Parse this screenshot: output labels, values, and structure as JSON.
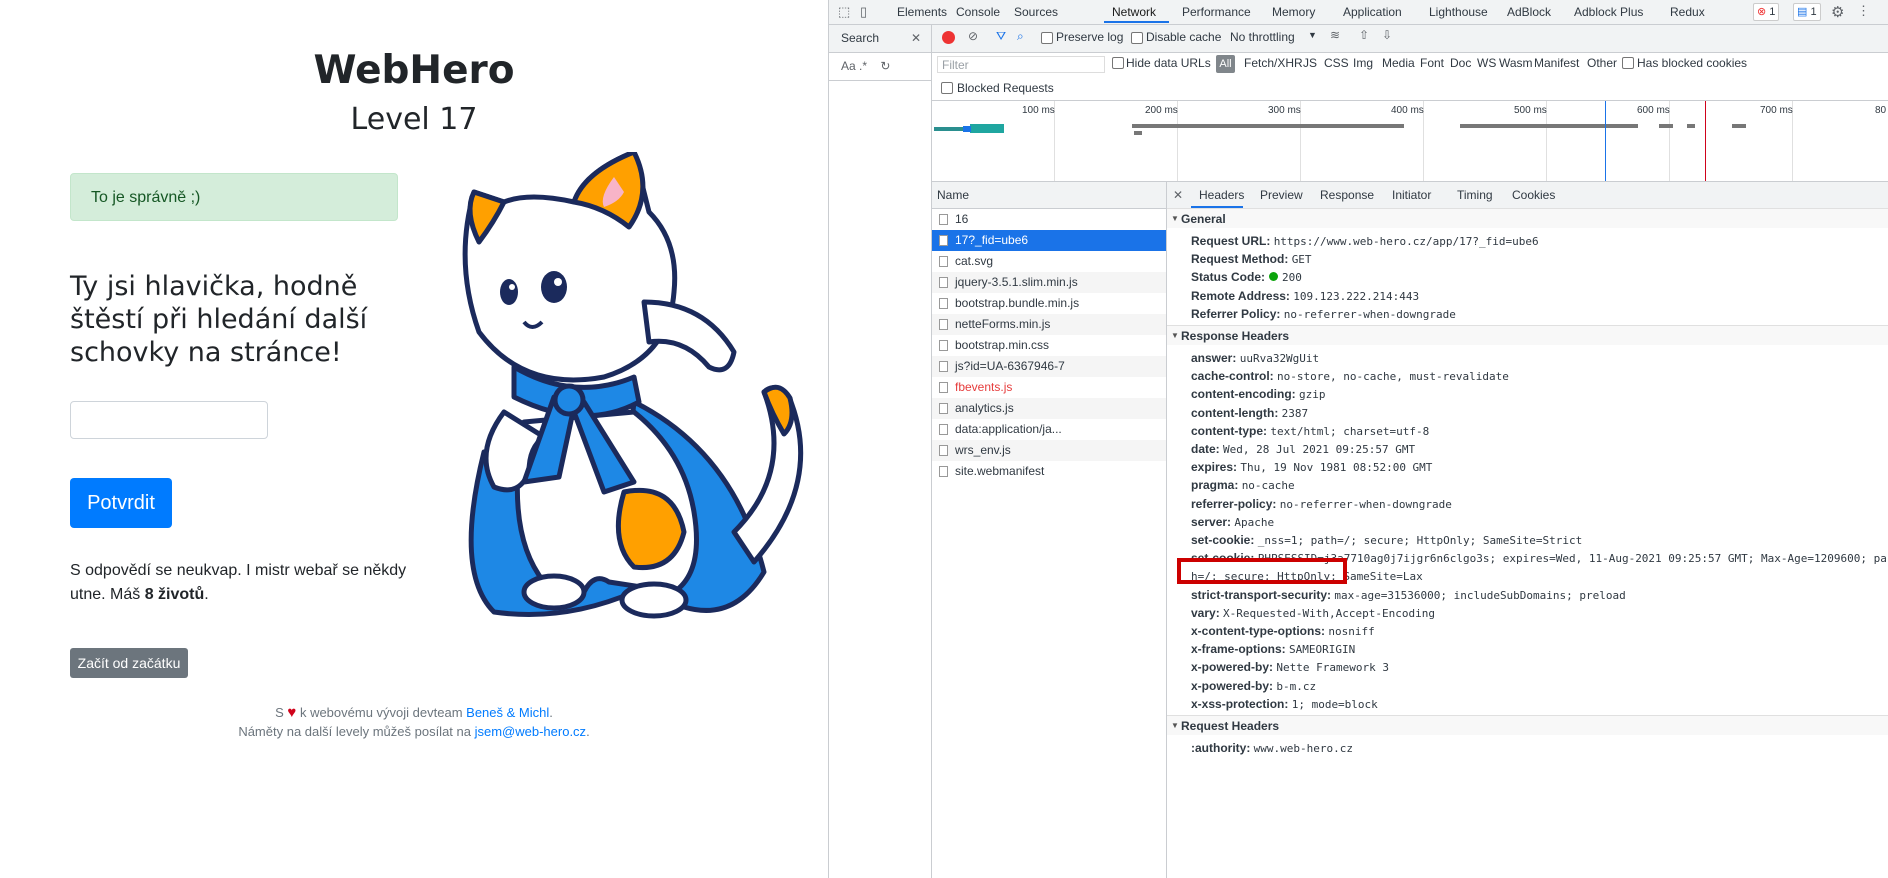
{
  "webpage": {
    "title": "WebHero",
    "level": "Level 17",
    "alert": "To je správně ;)",
    "hint": "Ty jsi hlavička, hodně štěstí při hledání další schovky na stránce!",
    "input_value": "",
    "submit_label": "Potvrdit",
    "lives_text_1": "S odpovědí se neukvap. I mistr webař se někdy utne. Máš ",
    "lives_count": "8 životů",
    "lives_text_2": ".",
    "restart_label": "Začít od začátku",
    "footer_1a": "S",
    "footer_1b": "k webovému vývoji devteam",
    "footer_link_1": "Beneš & Michl",
    "footer_1c": ".",
    "footer_2a": "Náměty na další levely můžeš posílat na",
    "footer_link_2": "jsem@web-hero.cz",
    "footer_2b": "."
  },
  "devtools": {
    "panels": [
      "Elements",
      "Console",
      "Sources",
      "Network",
      "Performance",
      "Memory",
      "Application",
      "Lighthouse",
      "AdBlock",
      "Adblock Plus",
      "Redux"
    ],
    "active_panel": "Network",
    "error_count": "1",
    "message_count": "1",
    "search_label": "Search",
    "search_opts": "Aa  .*",
    "preserve_log": "Preserve log",
    "disable_cache": "Disable cache",
    "throttling": "No throttling",
    "filter_placeholder": "Filter",
    "hide_data_urls": "Hide data URLs",
    "all": "All",
    "filter_types": [
      "Fetch/XHR",
      "JS",
      "CSS",
      "Img",
      "Media",
      "Font",
      "Doc",
      "WS",
      "Wasm",
      "Manifest",
      "Other"
    ],
    "has_blocked_cookies": "Has blocked cookies",
    "blocked_requests": "Blocked Requests",
    "timeline_ticks": [
      "100 ms",
      "200 ms",
      "300 ms",
      "400 ms",
      "500 ms",
      "600 ms",
      "700 ms",
      "80"
    ],
    "name_column": "Name",
    "requests": [
      {
        "name": "16",
        "state": ""
      },
      {
        "name": "17?_fid=ube6",
        "state": "selected"
      },
      {
        "name": "cat.svg",
        "state": ""
      },
      {
        "name": "jquery-3.5.1.slim.min.js",
        "state": ""
      },
      {
        "name": "bootstrap.bundle.min.js",
        "state": ""
      },
      {
        "name": "netteForms.min.js",
        "state": ""
      },
      {
        "name": "bootstrap.min.css",
        "state": ""
      },
      {
        "name": "js?id=UA-6367946-7",
        "state": ""
      },
      {
        "name": "fbevents.js",
        "state": "error"
      },
      {
        "name": "analytics.js",
        "state": ""
      },
      {
        "name": "data:application/ja...",
        "state": ""
      },
      {
        "name": "wrs_env.js",
        "state": ""
      },
      {
        "name": "site.webmanifest",
        "state": ""
      }
    ],
    "detail_tabs": [
      "Headers",
      "Preview",
      "Response",
      "Initiator",
      "Timing",
      "Cookies"
    ],
    "general_title": "General",
    "general": [
      {
        "name": "Request URL:",
        "value": "https://www.web-hero.cz/app/17?_fid=ube6"
      },
      {
        "name": "Request Method:",
        "value": "GET"
      },
      {
        "name": "Status Code:",
        "value": "200"
      },
      {
        "name": "Remote Address:",
        "value": "109.123.222.214:443"
      },
      {
        "name": "Referrer Policy:",
        "value": "no-referrer-when-downgrade"
      }
    ],
    "response_title": "Response Headers",
    "response": [
      {
        "name": "answer:",
        "value": "uuRva32WgUit"
      },
      {
        "name": "cache-control:",
        "value": "no-store, no-cache, must-revalidate"
      },
      {
        "name": "content-encoding:",
        "value": "gzip"
      },
      {
        "name": "content-length:",
        "value": "2387"
      },
      {
        "name": "content-type:",
        "value": "text/html; charset=utf-8"
      },
      {
        "name": "date:",
        "value": "Wed, 28 Jul 2021 09:25:57 GMT"
      },
      {
        "name": "expires:",
        "value": "Thu, 19 Nov 1981 08:52:00 GMT"
      },
      {
        "name": "pragma:",
        "value": "no-cache"
      },
      {
        "name": "referrer-policy:",
        "value": "no-referrer-when-downgrade"
      },
      {
        "name": "server:",
        "value": "Apache"
      },
      {
        "name": "set-cookie:",
        "value": "_nss=1; path=/; secure; HttpOnly; SameSite=Strict"
      },
      {
        "name": "set-cookie:",
        "value": "PHPSESSID=j3a7710ag0j7ijgr6n6clgo3s; expires=Wed, 11-Aug-2021 09:25:57 GMT; Max-Age=1209600; pa"
      },
      {
        "name": "",
        "value": "h=/; secure; HttpOnly; SameSite=Lax"
      },
      {
        "name": "strict-transport-security:",
        "value": "max-age=31536000; includeSubDomains; preload"
      },
      {
        "name": "vary:",
        "value": "X-Requested-With,Accept-Encoding"
      },
      {
        "name": "x-content-type-options:",
        "value": "nosniff"
      },
      {
        "name": "x-frame-options:",
        "value": "SAMEORIGIN"
      },
      {
        "name": "x-powered-by:",
        "value": "Nette Framework 3"
      },
      {
        "name": "x-powered-by:",
        "value": "b-m.cz"
      },
      {
        "name": "x-xss-protection:",
        "value": "1; mode=block"
      }
    ],
    "request_title": "Request Headers",
    "request": [
      {
        "name": ":authority:",
        "value": "www.web-hero.cz"
      }
    ],
    "colors": {
      "accent": "#1a73e8",
      "highlight_box": "#cc0000",
      "status_ok": "#0ca40c"
    }
  }
}
